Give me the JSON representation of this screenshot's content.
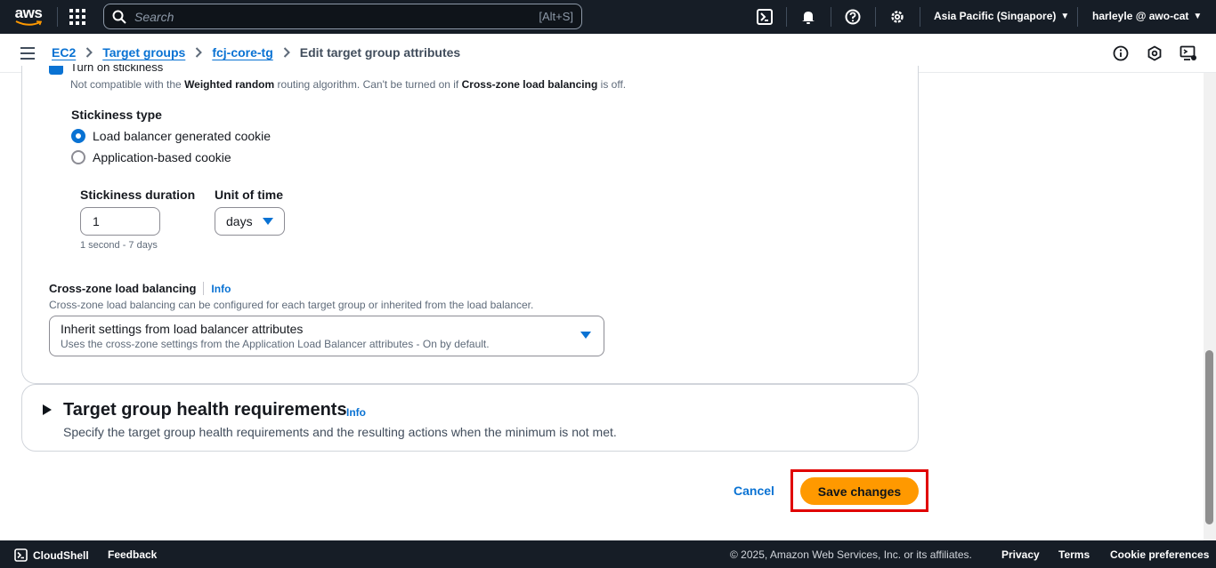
{
  "topnav": {
    "logo_text": "aws",
    "search_placeholder": "Search",
    "search_shortcut": "[Alt+S]",
    "region": "Asia Pacific (Singapore)",
    "account": "harleyle @ awo-cat",
    "icons": [
      "services-grid-icon",
      "cloudshell-icon",
      "bell-icon",
      "help-icon",
      "gear-icon"
    ]
  },
  "breadcrumb": {
    "items": [
      "EC2",
      "Target groups",
      "fcj-core-tg"
    ],
    "current": "Edit target group attributes",
    "right_icons": [
      "info-circle-icon",
      "settings-hex-icon",
      "feedback-monitor-icon"
    ]
  },
  "stickiness": {
    "checkbox_label": "Turn on stickiness",
    "helper_prefix": "Not compatible with the ",
    "helper_bold1": "Weighted random",
    "helper_mid": " routing algorithm. Can't be turned on if ",
    "helper_bold2": "Cross-zone load balancing",
    "helper_suffix": " is off.",
    "type_label": "Stickiness type",
    "option_lb": "Load balancer generated cookie",
    "option_app": "Application-based cookie",
    "selected": "Load balancer generated cookie",
    "duration_label": "Stickiness duration",
    "duration_value": "1",
    "duration_hint": "1 second - 7 days",
    "unit_label": "Unit of time",
    "unit_value": "days"
  },
  "cross_zone": {
    "label": "Cross-zone load balancing",
    "info": "Info",
    "helper": "Cross-zone load balancing can be configured for each target group or inherited from the load balancer.",
    "select_main": "Inherit settings from load balancer attributes",
    "select_sub": "Uses the cross-zone settings from the Application Load Balancer attributes - On by default."
  },
  "health": {
    "title": "Target group health requirements",
    "info": "Info",
    "description": "Specify the target group health requirements and the resulting actions when the minimum is not met."
  },
  "actions": {
    "cancel": "Cancel",
    "save": "Save changes"
  },
  "colors": {
    "primary_blue": "#0972d3",
    "save_orange": "#ff9900",
    "highlight_red": "#e00000",
    "nav_bg": "#161d26"
  },
  "footer": {
    "cloudshell": "CloudShell",
    "feedback": "Feedback",
    "copyright": "© 2025, Amazon Web Services, Inc. or its affiliates.",
    "privacy": "Privacy",
    "terms": "Terms",
    "cookie": "Cookie preferences"
  }
}
